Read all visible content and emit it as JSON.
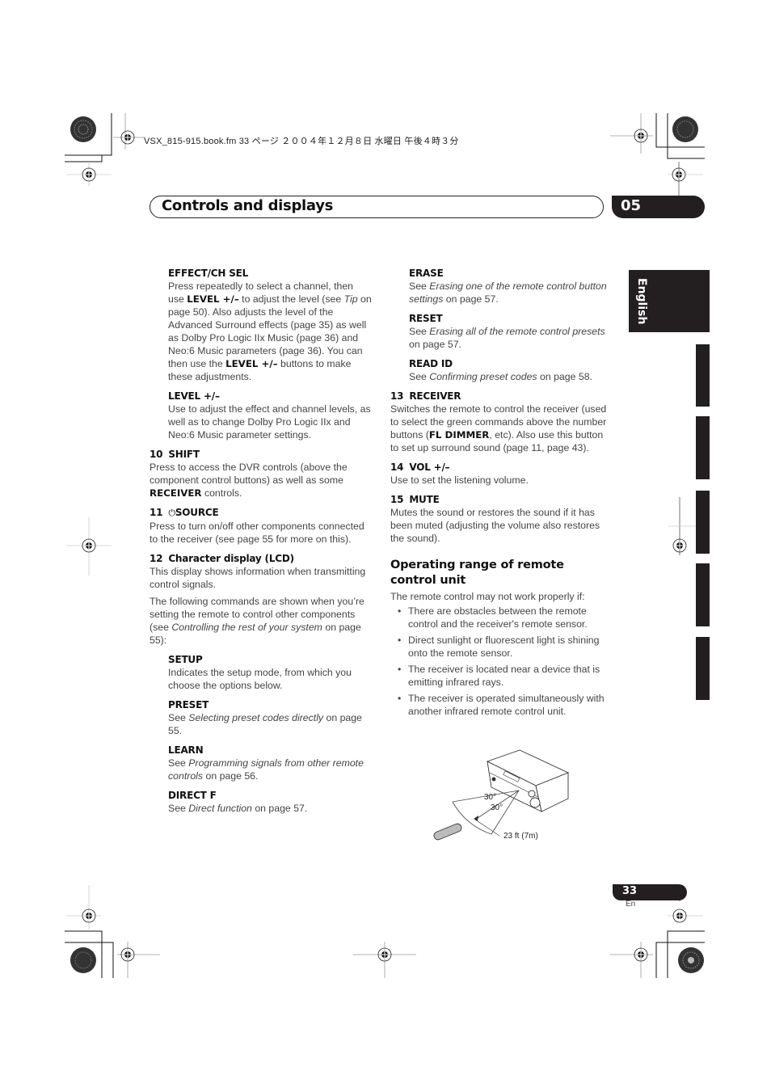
{
  "slug": "VSX_815-915.book.fm  33 ページ  ２００４年１２月８日  水曜日  午後４時３分",
  "header": {
    "title": "Controls and displays",
    "chapter": "05"
  },
  "language_tab": "English",
  "left_column": {
    "effect_ch_sel": {
      "title": "EFFECT/CH SEL",
      "t1": "Press repeatedly to select a channel, then use ",
      "b1": "LEVEL +/–",
      "t2": " to adjust the level (see ",
      "i1": "Tip",
      "t3": " on page 50). Also adjusts the level of the Advanced Surround effects (page 35) as well as Dolby Pro Logic IIx Music (page 36) and Neo:6 Music parameters (page 36). You can then use the ",
      "b2": "LEVEL +/–",
      "t4": " buttons to make these adjustments."
    },
    "level": {
      "title": "LEVEL +/–",
      "text": "Use to adjust the effect and channel levels, as well as to change Dolby Pro Logic IIx and Neo:6 Music parameter settings."
    },
    "shift": {
      "num": "10",
      "title": "SHIFT",
      "t1": "Press to access the DVR controls (above the component control buttons) as well as some ",
      "b1": "RECEIVER",
      "t2": " controls."
    },
    "source": {
      "num": "11",
      "icon": "⏻",
      "title": "SOURCE",
      "text": "Press to turn on/off other components connected to the receiver (see page 55 for more on this)."
    },
    "lcd": {
      "num": "12",
      "title": "Character display (LCD)",
      "text": "This display shows information when transmitting control signals.",
      "t1": "The following commands are shown when you’re setting the remote to control other components (see ",
      "i1": "Controlling the rest of your system",
      "t2": " on page 55):"
    },
    "setup": {
      "title": "SETUP",
      "text": "Indicates the setup mode, from which you choose the options below."
    },
    "preset": {
      "title": "PRESET",
      "t1": "See ",
      "i1": "Selecting preset codes directly",
      "t2": " on page 55."
    },
    "learn": {
      "title": "LEARN",
      "t1": "See ",
      "i1": "Programming signals from other remote controls",
      "t2": " on page 56."
    },
    "direct_f": {
      "title": "DIRECT F",
      "t1": "See ",
      "i1": "Direct function",
      "t2": " on page 57."
    }
  },
  "right_column": {
    "erase": {
      "title": "ERASE",
      "t1": "See ",
      "i1": "Erasing one of the remote control button settings",
      "t2": " on page 57."
    },
    "reset": {
      "title": "RESET",
      "t1": "See ",
      "i1": "Erasing all of the remote control presets",
      "t2": " on page 57."
    },
    "read_id": {
      "title": "READ ID",
      "t1": "See ",
      "i1": "Confirming preset codes",
      "t2": " on page 58."
    },
    "receiver": {
      "num": "13",
      "title": "RECEIVER",
      "t1": "Switches the remote to control the receiver (used to select the green commands above the number buttons (",
      "b1": "FL DIMMER",
      "t2": ", etc). Also use this button to set up surround sound (page 11, page 43)."
    },
    "vol": {
      "num": "14",
      "title": "VOL +/–",
      "text": "Use to set the listening volume."
    },
    "mute": {
      "num": "15",
      "title": "MUTE",
      "text": "Mutes the sound or restores the sound if it has been muted (adjusting the volume also restores the sound)."
    },
    "operating_range": {
      "title": "Operating range of remote control unit",
      "intro": "The remote control may not work properly if:",
      "bullets": [
        "There are obstacles between the remote control and the receiver's remote sensor.",
        "Direct sunlight or fluorescent light is shining onto the remote sensor.",
        "The receiver is located near a device that is emitting infrared rays.",
        "The receiver is operated simultaneously with another infrared remote control unit."
      ]
    },
    "diagram": {
      "angle1": "30°",
      "angle2": "30°",
      "distance": "23 ft (7m)"
    }
  },
  "footer": {
    "page": "33",
    "lang": "En"
  }
}
